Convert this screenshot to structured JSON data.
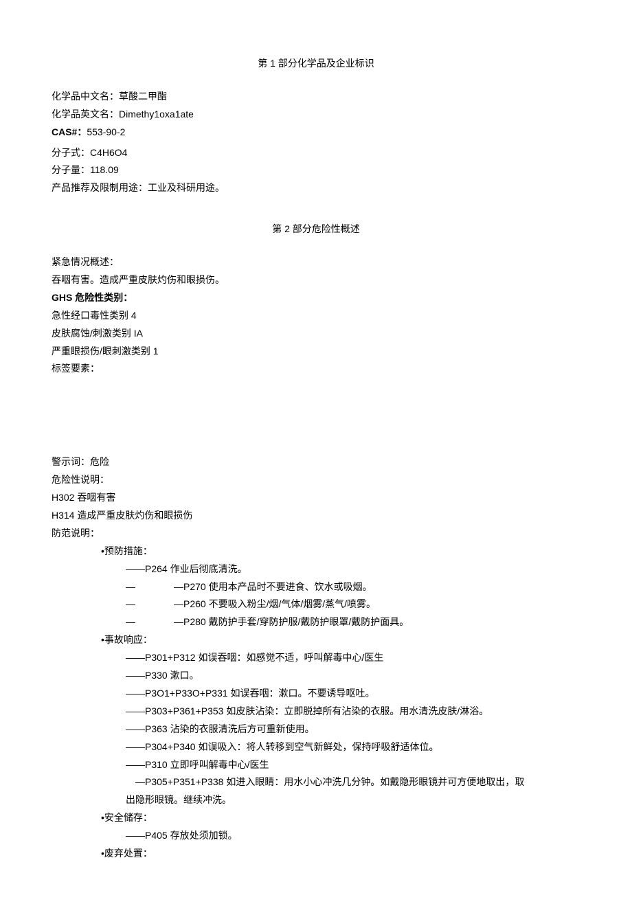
{
  "section1": {
    "title": "第 1 部分化学品及企业标识",
    "nameCnLabel": "化学品中文名：",
    "nameCn": "草酸二甲酯",
    "nameEnLabel": "化学品英文名：",
    "nameEn": "Dimethy1oxa1ate",
    "casLabel": "CAS#：",
    "cas": "553-90-2",
    "formulaLabel": "分子式：",
    "formula": "C4H6O4",
    "mwLabel": "分子量：",
    "mw": "118.09",
    "useLabel": "产品推荐及限制用途：",
    "use": "工业及科研用途。"
  },
  "section2": {
    "title": "第 2 部分危险性概述",
    "emergencyLabel": "紧急情况概述：",
    "emergencyText": "吞咽有害。造成严重皮肤灼伤和眼损伤。",
    "ghsLabel": "GHS 危险性类别：",
    "ghs1": "急性经口毒性类别 4",
    "ghs2": "皮肤腐蚀/刺激类别 IA",
    "ghs3": "严重眼损伤/眼刺激类别 1",
    "labelElemLabel": "标签要素：",
    "signalLabel": "警示词：",
    "signal": "危险",
    "hazardLabel": "危险性说明：",
    "h302": "H302 吞咽有害",
    "h314": "H314 造成严重皮肤灼伤和眼损伤",
    "precautionLabel": "防范说明：",
    "prevention": {
      "header": "•预防措施：",
      "p264": "——P264 作业后彻底清洗。",
      "p270_dash1": "—",
      "p270": "—P270 使用本产品时不要进食、饮水或吸烟。",
      "p260_dash1": "—",
      "p260": "—P260 不要吸入粉尘/烟/气体/烟雾/蒸气/喷雾。",
      "p280_dash1": "—",
      "p280": "—P280 戴防护手套/穿防护服/戴防护眼罩/戴防护面具。"
    },
    "response": {
      "header": "•事故响应：",
      "p301p312": "——P301+P312 如误吞咽：如感觉不适，呼叫解毒中心/医生",
      "p330": "——P330 漱口。",
      "p301p330p331": "——P3O1+P33O+P331 如误吞咽：漱口。不要诱导呕吐。",
      "p303p361p353": "——P303+P361+P353 如皮肤沾染：立即脱掉所有沾染的衣服。用水清洗皮肤/淋浴。",
      "p363": "——P363 沾染的衣服清洗后方可重新使用。",
      "p304p340": "——P304+P340 如误吸入：将人转移到空气新鲜处，保持呼吸舒适体位。",
      "p310": "——P310 立即呼叫解毒中心/医生",
      "p305_line1": "—P305+P351+P338 如进入眼睛：用水小心冲洗几分钟。如戴隐形眼镜并可方便地取出，取",
      "p305_line2": "出隐形眼镜。继续冲洗。"
    },
    "storage": {
      "header": "•安全储存：",
      "p405": "——P405 存放处须加锁。"
    },
    "disposal": {
      "header": "•废弃处置："
    }
  }
}
